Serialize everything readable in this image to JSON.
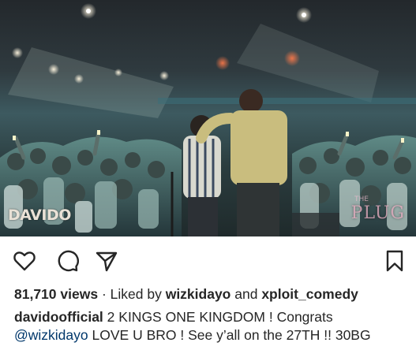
{
  "media": {
    "watermark_left": "DAVIDO",
    "watermark_right_small": "THE",
    "watermark_right": "PLUG"
  },
  "actions": {
    "icons": [
      "heart-icon",
      "comment-icon",
      "share-icon",
      "bookmark-icon"
    ]
  },
  "stats": {
    "views": "81,710 views",
    "separator": "·",
    "liked_by_label": "Liked by",
    "liker_1": "wizkidayo",
    "and_label": "and",
    "liker_2": "xploit_comedy"
  },
  "caption": {
    "username": "davidoofficial",
    "line1_text": "2 KINGS ONE KINGDOM ! Congrats",
    "mention": "@wizkidayo",
    "line2_text": "LOVE U BRO ! See y’all on the 27TH !! 30BG"
  },
  "colors": {
    "text": "#262626",
    "mention": "#00376b",
    "icon": "#262626"
  }
}
